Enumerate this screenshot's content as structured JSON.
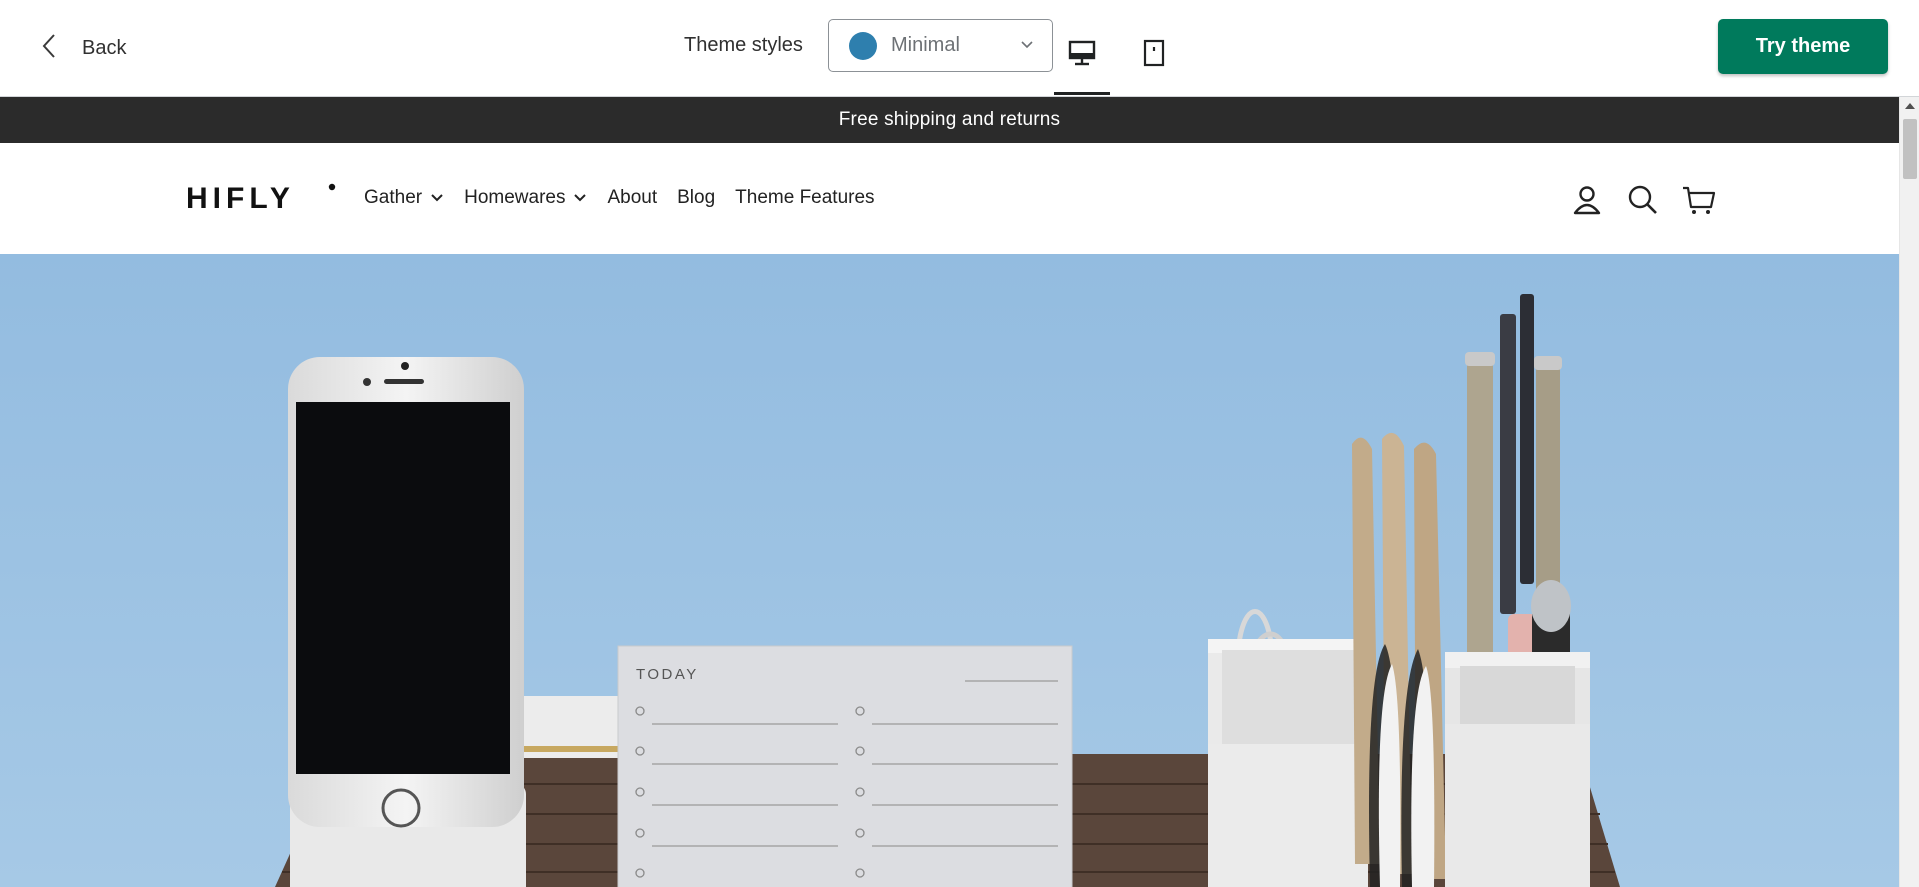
{
  "topbar": {
    "back_label": "Back",
    "theme_styles_label": "Theme styles",
    "style_select": {
      "selected": "Minimal",
      "swatch_color": "#2e7fae"
    },
    "device_buttons": [
      {
        "icon": "desktop-icon",
        "active": true
      },
      {
        "icon": "mobile-icon",
        "active": false
      }
    ],
    "try_theme_label": "Try theme",
    "try_theme_color": "#007a5c"
  },
  "store": {
    "announcement": "Free shipping and returns",
    "logo": "HIFLY",
    "nav": [
      {
        "label": "Gather",
        "has_dropdown": true
      },
      {
        "label": "Homewares",
        "has_dropdown": true
      },
      {
        "label": "About",
        "has_dropdown": false
      },
      {
        "label": "Blog",
        "has_dropdown": false
      },
      {
        "label": "Theme Features",
        "has_dropdown": false
      }
    ],
    "header_icons": [
      "account-icon",
      "search-icon",
      "cart-icon"
    ],
    "hero": {
      "note_title": "TODAY",
      "background_color": "#9dc2e1"
    }
  }
}
